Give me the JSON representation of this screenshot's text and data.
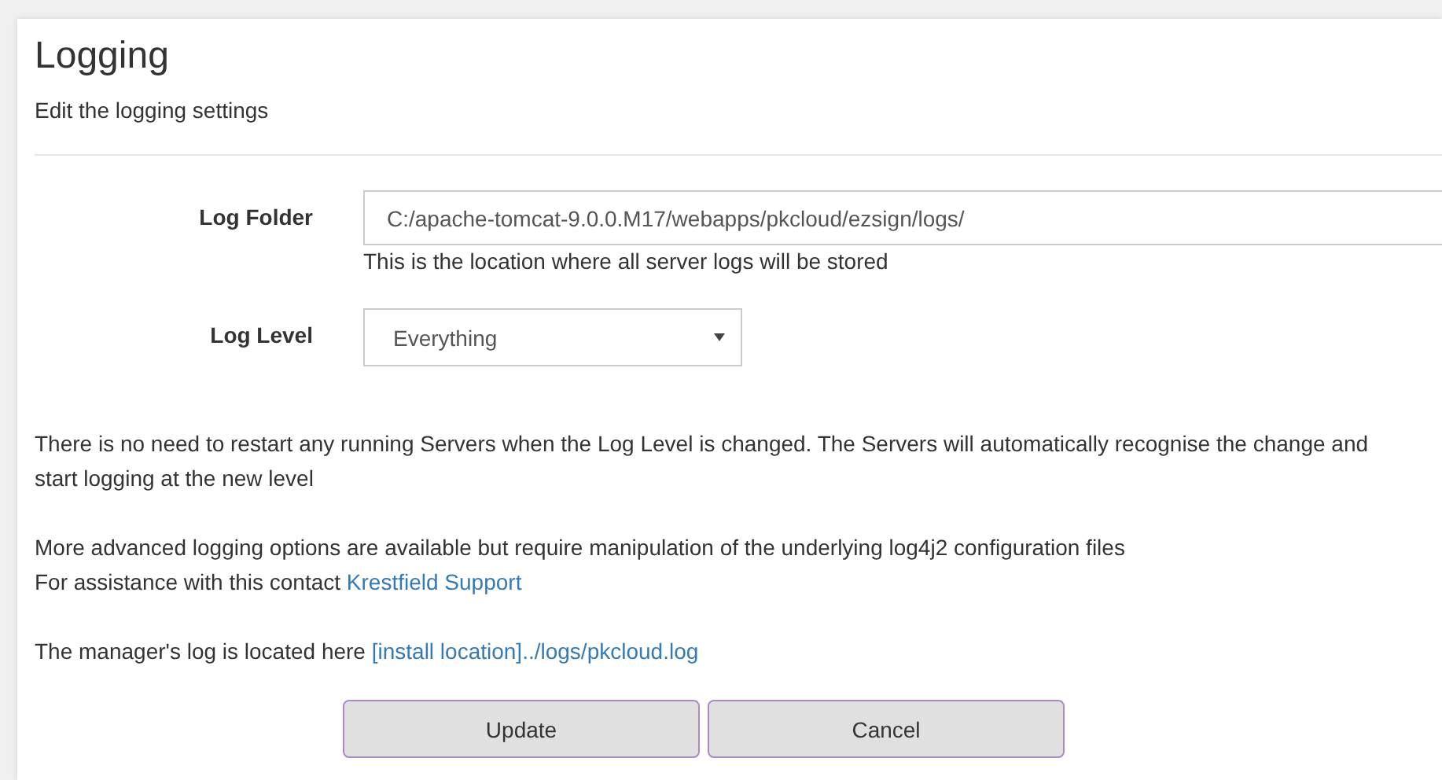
{
  "header": {
    "title": "Logging",
    "subtitle": "Edit the logging settings"
  },
  "fields": [
    {
      "kind": "text",
      "label": "Log Folder",
      "value": "C:/apache-tomcat-9.0.0.M17/webapps/pkcloud/ezsign/logs/",
      "help": "This is the location where all server logs will be stored"
    },
    {
      "kind": "select",
      "label": "Log Level",
      "value": "Everything"
    }
  ],
  "paragraphs": [
    {
      "lines": [
        {
          "text": "There is no need to restart any running Servers when the Log Level is changed. The Servers will automatically recognise the change and start logging at the new level"
        }
      ]
    },
    {
      "lines": [
        {
          "text": "More advanced logging options are available but require manipulation of the underlying log4j2 configuration files"
        },
        {
          "text": "For assistance with this contact ",
          "link": "Krestfield Support"
        }
      ]
    },
    {
      "lines": [
        {
          "text": "The manager's log is located here ",
          "link": "[install location]../logs/pkcloud.log"
        }
      ]
    }
  ],
  "buttons": [
    "Update",
    "Cancel"
  ]
}
